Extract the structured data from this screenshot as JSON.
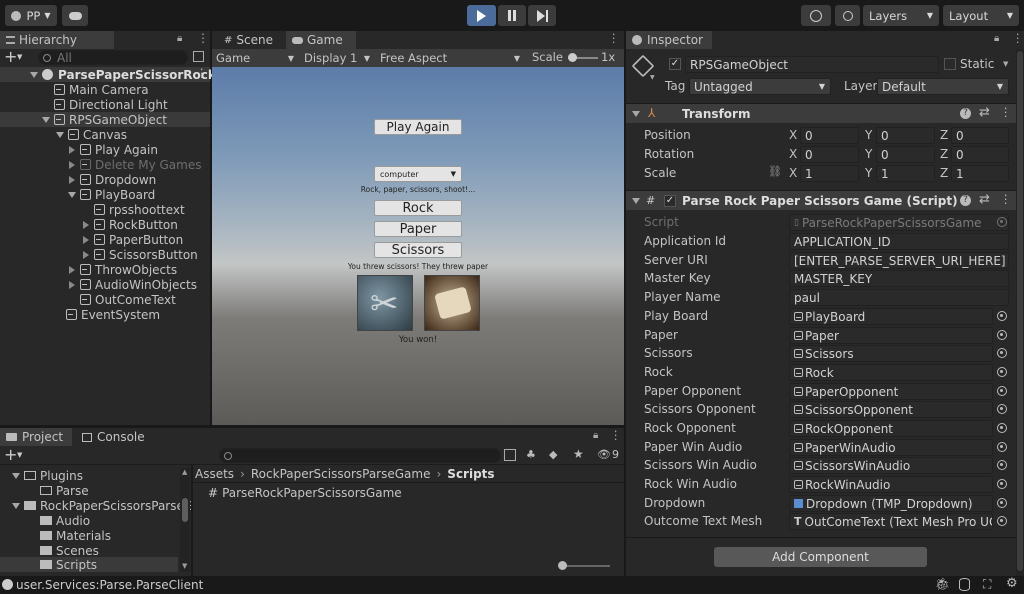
{
  "toolbar": {
    "account": "PP",
    "layers": "Layers",
    "layout": "Layout"
  },
  "hierarchy": {
    "tab": "Hierarchy",
    "search_placeholder": "All",
    "items": [
      {
        "label": "ParsePaperScissorRock"
      },
      {
        "label": "Main Camera"
      },
      {
        "label": "Directional Light"
      },
      {
        "label": "RPSGameObject"
      },
      {
        "label": "Canvas"
      },
      {
        "label": "Play Again"
      },
      {
        "label": "Delete My Games"
      },
      {
        "label": "Dropdown"
      },
      {
        "label": "PlayBoard"
      },
      {
        "label": "rpsshoottext"
      },
      {
        "label": "RockButton"
      },
      {
        "label": "PaperButton"
      },
      {
        "label": "ScissorsButton"
      },
      {
        "label": "ThrowObjects"
      },
      {
        "label": "AudioWinObjects"
      },
      {
        "label": "OutComeText"
      },
      {
        "label": "EventSystem"
      }
    ]
  },
  "scene": {
    "tab_scene": "Scene",
    "tab_game": "Game",
    "game_dropdown": "Game",
    "display": "Display 1",
    "aspect": "Free Aspect",
    "scale_label": "Scale",
    "scale_value": "1x",
    "play_again": "Play Again",
    "dropdown_value": "computer",
    "shoot_text": "Rock, paper, scissors, shoot!...",
    "rock": "Rock",
    "paper": "Paper",
    "scissors": "Scissors",
    "throw_text": "You threw scissors! They threw paper",
    "outcome": "You won!"
  },
  "inspector": {
    "tab": "Inspector",
    "object_name": "RPSGameObject",
    "static_label": "Static",
    "tag_label": "Tag",
    "tag_value": "Untagged",
    "layer_label": "Layer",
    "layer_value": "Default",
    "transform_title": "Transform",
    "transform": [
      {
        "label": "Position",
        "x": "0",
        "y": "0",
        "z": "0"
      },
      {
        "label": "Rotation",
        "x": "0",
        "y": "0",
        "z": "0"
      },
      {
        "label": "Scale",
        "x": "1",
        "y": "1",
        "z": "1"
      }
    ],
    "axis_x": "X",
    "axis_y": "Y",
    "axis_z": "Z",
    "script_title": "Parse Rock Paper Scissors Game (Script)",
    "fields": [
      {
        "label": "Script",
        "value": "ParseRockPaperScissorsGame"
      },
      {
        "label": "Application Id",
        "value": "APPLICATION_ID"
      },
      {
        "label": "Server URI",
        "value": "[ENTER_PARSE_SERVER_URI_HERE]"
      },
      {
        "label": "Master Key",
        "value": "MASTER_KEY"
      },
      {
        "label": "Player Name",
        "value": "paul"
      },
      {
        "label": "Play Board",
        "value": "PlayBoard"
      },
      {
        "label": "Paper",
        "value": "Paper"
      },
      {
        "label": "Scissors",
        "value": "Scissors"
      },
      {
        "label": "Rock",
        "value": "Rock"
      },
      {
        "label": "Paper Opponent",
        "value": "PaperOpponent"
      },
      {
        "label": "Scissors Opponent",
        "value": "ScissorsOpponent"
      },
      {
        "label": "Rock Opponent",
        "value": "RockOpponent"
      },
      {
        "label": "Paper Win Audio",
        "value": "PaperWinAudio"
      },
      {
        "label": "Scissors Win Audio",
        "value": "ScissorsWinAudio"
      },
      {
        "label": "Rock Win Audio",
        "value": "RockWinAudio"
      },
      {
        "label": "Dropdown",
        "value": "Dropdown (TMP_Dropdown)"
      },
      {
        "label": "Outcome Text Mesh",
        "value": "OutComeText (Text Mesh Pro UGUI)"
      }
    ],
    "add_component": "Add Component"
  },
  "project": {
    "tab_project": "Project",
    "tab_console": "Console",
    "count": "9",
    "tree": [
      {
        "label": "Plugins"
      },
      {
        "label": "Parse"
      },
      {
        "label": "RockPaperScissorsParseG"
      },
      {
        "label": "Audio"
      },
      {
        "label": "Materials"
      },
      {
        "label": "Scenes"
      },
      {
        "label": "Scripts"
      }
    ],
    "breadcrumb": [
      "Assets",
      "RockPaperScissorsParseGame",
      "Scripts"
    ],
    "file": "ParseRockPaperScissorsGame"
  },
  "status": {
    "text": "user.Services:Parse.ParseClient"
  }
}
